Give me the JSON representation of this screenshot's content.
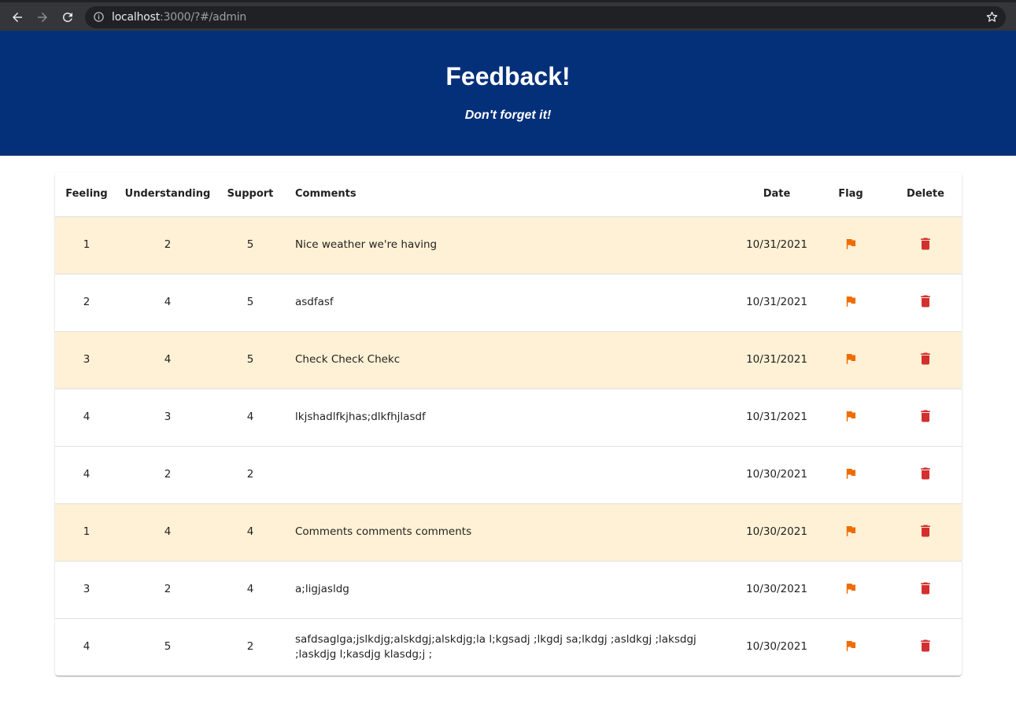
{
  "browser": {
    "url_host": "localhost",
    "url_rest": ":3000/?#/admin",
    "icons": [
      "back-arrow-icon",
      "forward-arrow-icon",
      "reload-icon",
      "info-icon",
      "star-icon"
    ]
  },
  "header": {
    "title": "Feedback!",
    "subtitle": "Don't forget it!",
    "background": "#04307a"
  },
  "table": {
    "columns": [
      "Feeling",
      "Understanding",
      "Support",
      "Comments",
      "Date",
      "Flag",
      "Delete"
    ],
    "flag_color": "#ef6c00",
    "delete_color": "#d32f2f",
    "flagged_row_color": "#fff1d6",
    "rows": [
      {
        "feeling": "1",
        "understanding": "2",
        "support": "5",
        "comments": "Nice weather we're having",
        "date": "10/31/2021",
        "flagged": true
      },
      {
        "feeling": "2",
        "understanding": "4",
        "support": "5",
        "comments": "asdfasf",
        "date": "10/31/2021",
        "flagged": false
      },
      {
        "feeling": "3",
        "understanding": "4",
        "support": "5",
        "comments": "Check Check Chekc",
        "date": "10/31/2021",
        "flagged": true
      },
      {
        "feeling": "4",
        "understanding": "3",
        "support": "4",
        "comments": "lkjshadlfkjhas;dlkfhjlasdf",
        "date": "10/31/2021",
        "flagged": false
      },
      {
        "feeling": "4",
        "understanding": "2",
        "support": "2",
        "comments": "",
        "date": "10/30/2021",
        "flagged": false
      },
      {
        "feeling": "1",
        "understanding": "4",
        "support": "4",
        "comments": "Comments comments comments",
        "date": "10/30/2021",
        "flagged": true
      },
      {
        "feeling": "3",
        "understanding": "2",
        "support": "4",
        "comments": "a;ligjasldg",
        "date": "10/30/2021",
        "flagged": false
      },
      {
        "feeling": "4",
        "understanding": "5",
        "support": "2",
        "comments": "safdsaglga;jslkdjg;alskdgj;alskdjg;la l;kgsadj ;lkgdj sa;lkdgj ;asldkgj ;laksdgj ;laskdjg l;kasdjg klasdg;j ;",
        "date": "10/30/2021",
        "flagged": false
      }
    ]
  }
}
